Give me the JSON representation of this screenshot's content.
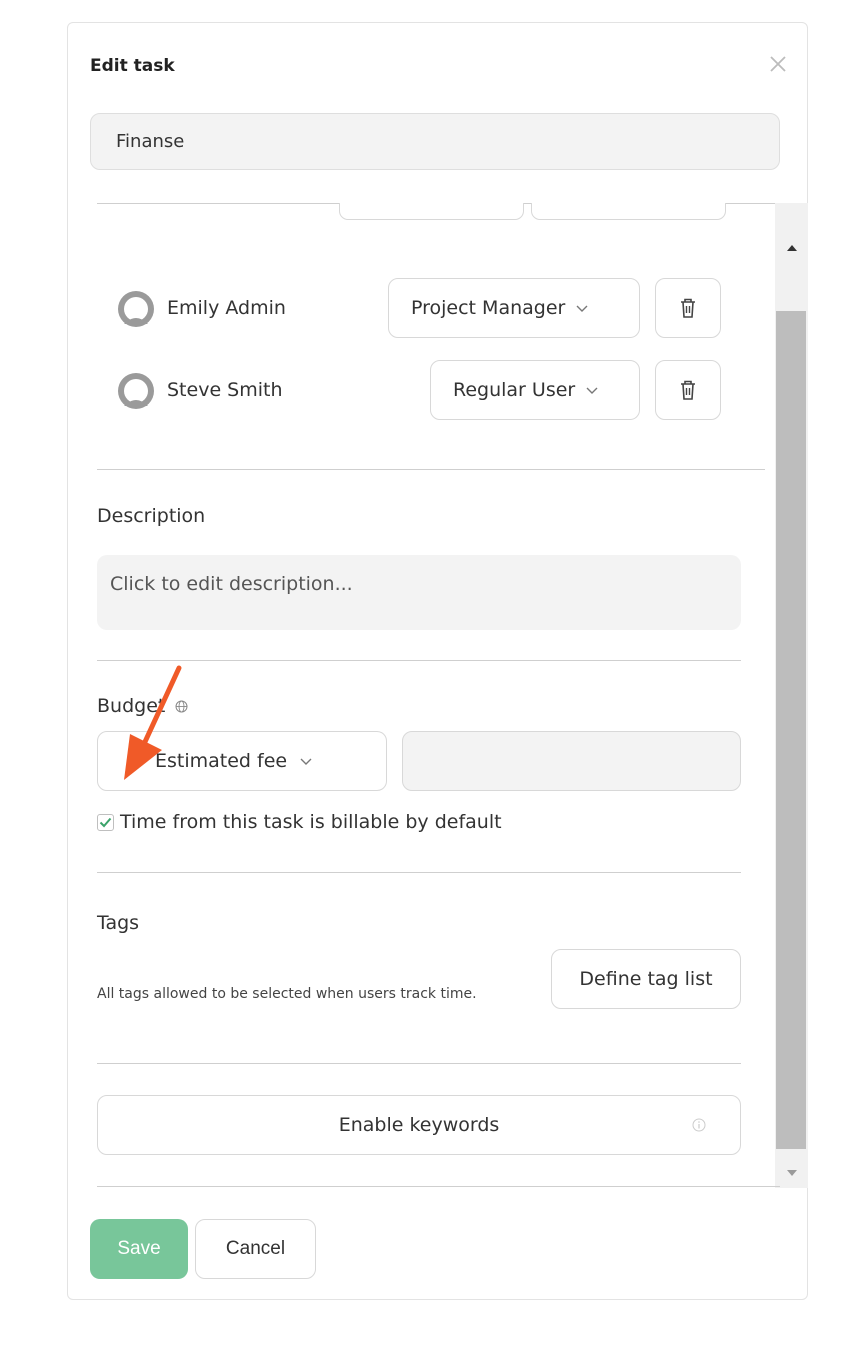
{
  "dialog": {
    "title": "Edit task",
    "task_name": "Finanse"
  },
  "members": [
    {
      "name": "Emily Admin",
      "role": "Project Manager"
    },
    {
      "name": "Steve Smith",
      "role": "Regular User"
    }
  ],
  "description": {
    "heading": "Description",
    "placeholder": "Click to edit description..."
  },
  "budget": {
    "heading": "Budget",
    "type_selected": "Estimated fee",
    "amount": "",
    "billable_label": "Time from this task is billable by default",
    "billable_checked": true
  },
  "tags": {
    "heading": "Tags",
    "help_text": "All tags allowed to be selected when users track time.",
    "define_button": "Define tag list"
  },
  "keywords": {
    "button": "Enable keywords"
  },
  "footer": {
    "save_label": "Save",
    "cancel_label": "Cancel"
  },
  "colors": {
    "accent_green": "#78c69a",
    "checkmark": "#3aa36a",
    "annotation_arrow": "#f05a28",
    "input_background": "#f3f3f3"
  },
  "icons": {
    "close": "close-icon",
    "avatar": "user-avatar-icon",
    "dropdown": "chevron-down-icon",
    "delete": "trash-icon",
    "budget_help": "globe-icon",
    "keywords_info": "info-icon"
  }
}
